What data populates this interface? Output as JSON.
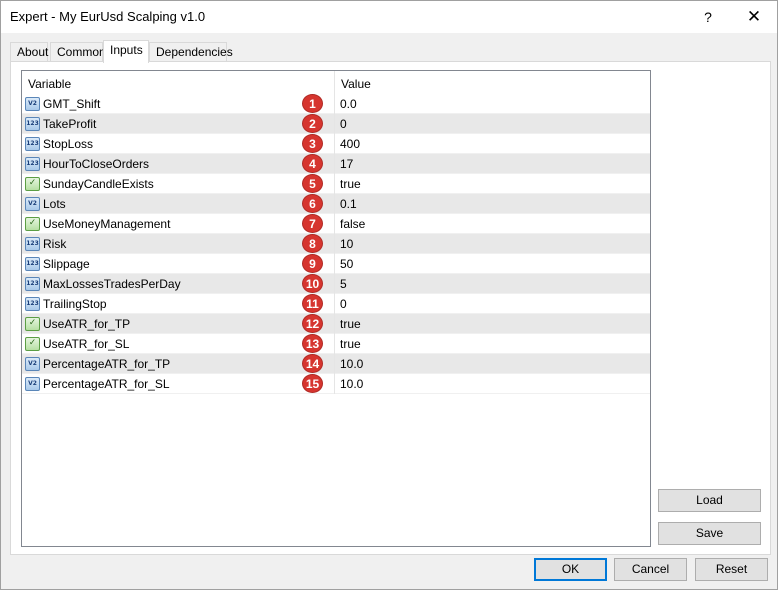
{
  "window": {
    "title": "Expert - My EurUsd Scalping v1.0",
    "help_label": "?",
    "close_label": "✕"
  },
  "tabs": [
    {
      "label": "About"
    },
    {
      "label": "Common"
    },
    {
      "label": "Inputs"
    },
    {
      "label": "Dependencies"
    }
  ],
  "grid": {
    "col_variable": "Variable",
    "col_value": "Value",
    "rows": [
      {
        "num": "1",
        "icon": "V2",
        "type_icon": "double-icon",
        "name": "GMT_Shift",
        "value": "0.0"
      },
      {
        "num": "2",
        "icon": "123",
        "type_icon": "int-icon",
        "name": "TakeProfit",
        "value": "0"
      },
      {
        "num": "3",
        "icon": "123",
        "type_icon": "int-icon",
        "name": "StopLoss",
        "value": "400"
      },
      {
        "num": "4",
        "icon": "123",
        "type_icon": "int-icon",
        "name": "HourToCloseOrders",
        "value": "17"
      },
      {
        "num": "5",
        "icon": "✓",
        "type_icon": "bool-icon",
        "name": "SundayCandleExists",
        "value": "true"
      },
      {
        "num": "6",
        "icon": "V2",
        "type_icon": "double-icon",
        "name": "Lots",
        "value": "0.1"
      },
      {
        "num": "7",
        "icon": "✓",
        "type_icon": "bool-icon",
        "name": "UseMoneyManagement",
        "value": "false"
      },
      {
        "num": "8",
        "icon": "123",
        "type_icon": "int-icon",
        "name": "Risk",
        "value": "10"
      },
      {
        "num": "9",
        "icon": "123",
        "type_icon": "int-icon",
        "name": "Slippage",
        "value": "50"
      },
      {
        "num": "10",
        "icon": "123",
        "type_icon": "int-icon",
        "name": "MaxLossesTradesPerDay",
        "value": "5"
      },
      {
        "num": "11",
        "icon": "123",
        "type_icon": "int-icon",
        "name": "TrailingStop",
        "value": "0"
      },
      {
        "num": "12",
        "icon": "✓",
        "type_icon": "bool-icon",
        "name": "UseATR_for_TP",
        "value": "true"
      },
      {
        "num": "13",
        "icon": "✓",
        "type_icon": "bool-icon",
        "name": "UseATR_for_SL",
        "value": "true"
      },
      {
        "num": "14",
        "icon": "V2",
        "type_icon": "double-icon",
        "name": "PercentageATR_for_TP",
        "value": "10.0"
      },
      {
        "num": "15",
        "icon": "V2",
        "type_icon": "double-icon",
        "name": "PercentageATR_for_SL",
        "value": "10.0"
      }
    ]
  },
  "side_buttons": {
    "load": "Load",
    "save": "Save"
  },
  "bottom_buttons": {
    "ok": "OK",
    "cancel": "Cancel",
    "reset": "Reset"
  },
  "colors": {
    "badge": "#d6352f",
    "accent": "#0078d7"
  }
}
